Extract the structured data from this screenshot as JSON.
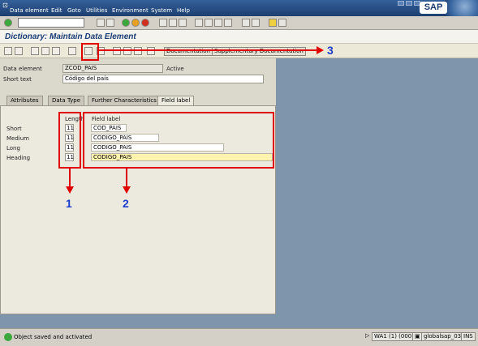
{
  "menubar": {
    "items": [
      "Data element",
      "Edit",
      "Goto",
      "Utilities",
      "Environment",
      "System",
      "Help"
    ],
    "logo": "SAP"
  },
  "title": "Dictionary: Maintain Data Element",
  "app_toolbar": {
    "documentation": "Documentation",
    "supplementary": "Supplementary Documentation"
  },
  "header": {
    "data_element_label": "Data element",
    "data_element_value": "ZCOD_PAIS",
    "status": "Active",
    "short_text_label": "Short text",
    "short_text_value": "Código del país"
  },
  "tabs": [
    "Attributes",
    "Data Type",
    "Further Characteristics",
    "Field label"
  ],
  "active_tab": "Field label",
  "field_label": {
    "length_header": "Length",
    "label_header": "Field label",
    "rows": [
      {
        "name": "Short",
        "length": "11",
        "label": "COD_PAIS"
      },
      {
        "name": "Medium",
        "length": "11",
        "label": "CODIGO_PAIS"
      },
      {
        "name": "Long",
        "length": "11",
        "label": "CODIGO_PAIS"
      },
      {
        "name": "Heading",
        "length": "11",
        "label": "CODIGO_PAIS"
      }
    ]
  },
  "callouts": [
    "1",
    "2",
    "3"
  ],
  "status": {
    "message": "Object saved and activated",
    "system": "WA1 (1) (000)",
    "server": "globalsap_03",
    "mode": "INS"
  },
  "colors": {
    "title": "#1a3c75",
    "annotation_red": "#e00000",
    "annotation_blue": "#1a3ccc",
    "background": "#7e95ac"
  }
}
